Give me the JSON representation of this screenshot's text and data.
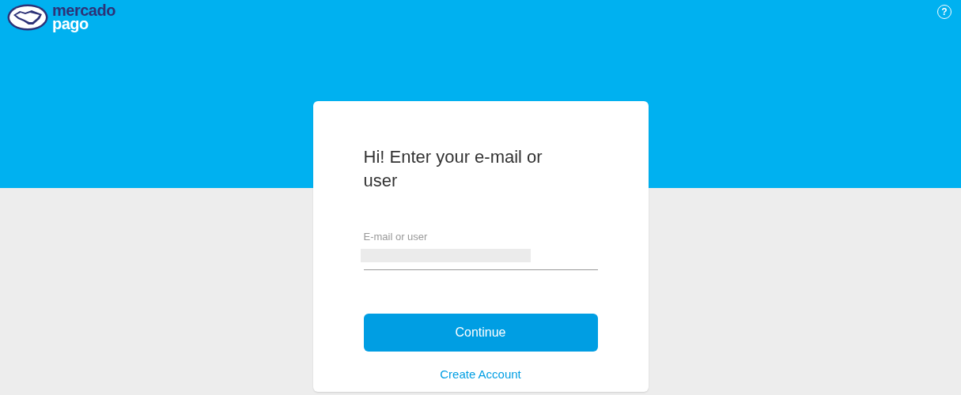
{
  "header": {
    "logo_top": "mercado",
    "logo_bottom": "pago",
    "help_button": "?"
  },
  "login": {
    "title": "Hi! Enter your e-mail or user",
    "field_label": "E-mail or user",
    "value_redacted": true,
    "continue_button": "Continue",
    "create_account_link": "Create Account"
  }
}
